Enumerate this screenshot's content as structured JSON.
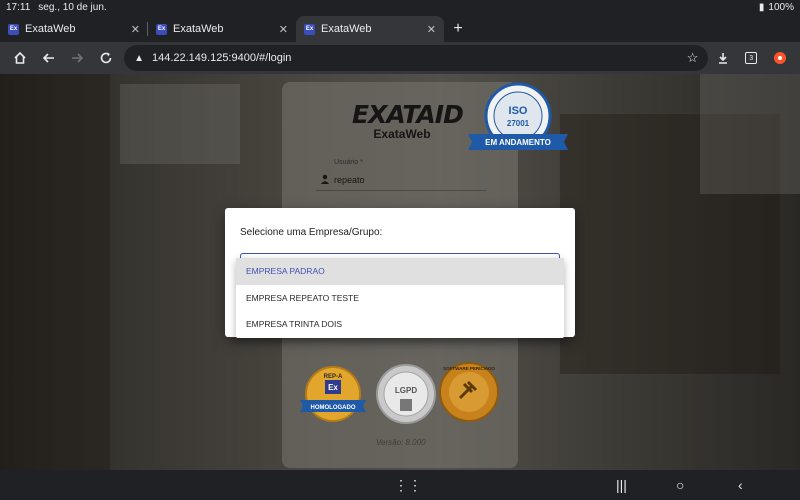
{
  "status_bar": {
    "time": "17:11",
    "date": "seg., 10 de jun.",
    "battery": "100%"
  },
  "tabs": [
    {
      "favicon": "Ex",
      "title": "ExataWeb"
    },
    {
      "favicon": "Ex",
      "title": "ExataWeb"
    },
    {
      "favicon": "Ex",
      "title": "ExataWeb"
    }
  ],
  "toolbar": {
    "url": "144.22.149.125:9400/#/login",
    "tab_count": "3"
  },
  "login": {
    "brand": "EXATAID",
    "brand_sub": "ExataWeb",
    "iso_number": "ISO",
    "iso_code": "27001",
    "iso_status": "EM ANDAMENTO",
    "user_label": "Usuário *",
    "user_value": "repeato",
    "seal_1_top": "REP-A",
    "seal_1_mid": "Ex",
    "seal_1_band": "HOMOLOGADO",
    "seal_2": "LGPD",
    "seal_3_top": "SOFTWARE PERICIADO",
    "version": "Versão: 8.000"
  },
  "dialog": {
    "title": "Selecione uma Empresa/Grupo:",
    "options": [
      "EMPRESA PADRAO",
      "EMPRESA REPEATO TESTE",
      "EMPRESA TRINTA DOIS"
    ]
  },
  "colors": {
    "accent": "#3f51b5",
    "selected_bg": "#e0e0e0",
    "iso_blue": "#1e5aa8",
    "seal_gold": "#d18a1e"
  }
}
